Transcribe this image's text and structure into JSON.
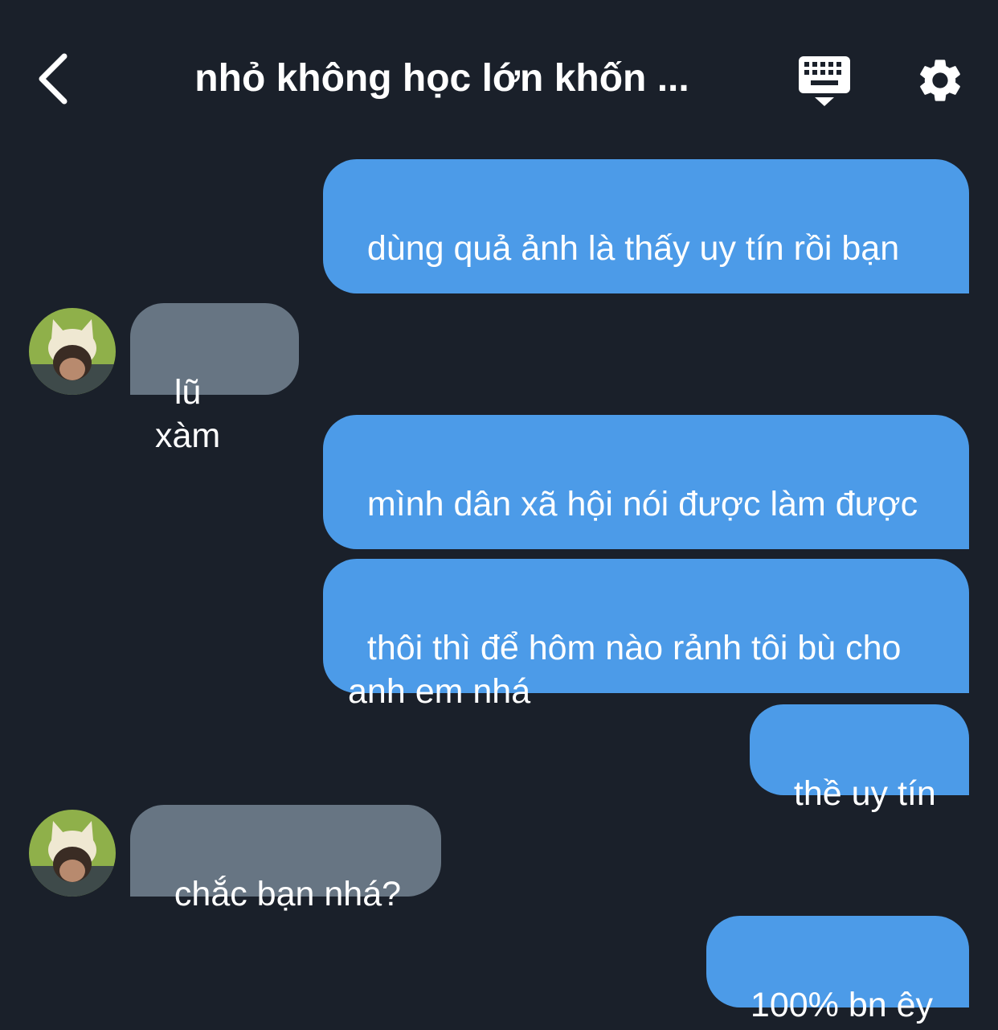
{
  "header": {
    "title": "nhỏ không học lớn khốn ...",
    "back_icon": "chevron-left-icon",
    "keyboard_icon": "keyboard-icon",
    "settings_icon": "gear-icon"
  },
  "colors": {
    "background": "#1a202a",
    "outgoing_bubble": "#4c9be8",
    "incoming_bubble": "#677583",
    "text": "#ffffff"
  },
  "messages": [
    {
      "direction": "outgoing",
      "text": "dùng quả ảnh là thấy uy tín rồi bạn"
    },
    {
      "direction": "incoming",
      "text": "lũ xàm"
    },
    {
      "direction": "outgoing",
      "text": "mình dân xã hội nói được làm được"
    },
    {
      "direction": "outgoing",
      "text": "thôi thì để hôm nào rảnh tôi bù cho anh em nhá"
    },
    {
      "direction": "outgoing",
      "text": "thề uy tín"
    },
    {
      "direction": "incoming",
      "text": "chắc bạn nhá?"
    },
    {
      "direction": "outgoing",
      "text": "100% bn êy"
    }
  ]
}
